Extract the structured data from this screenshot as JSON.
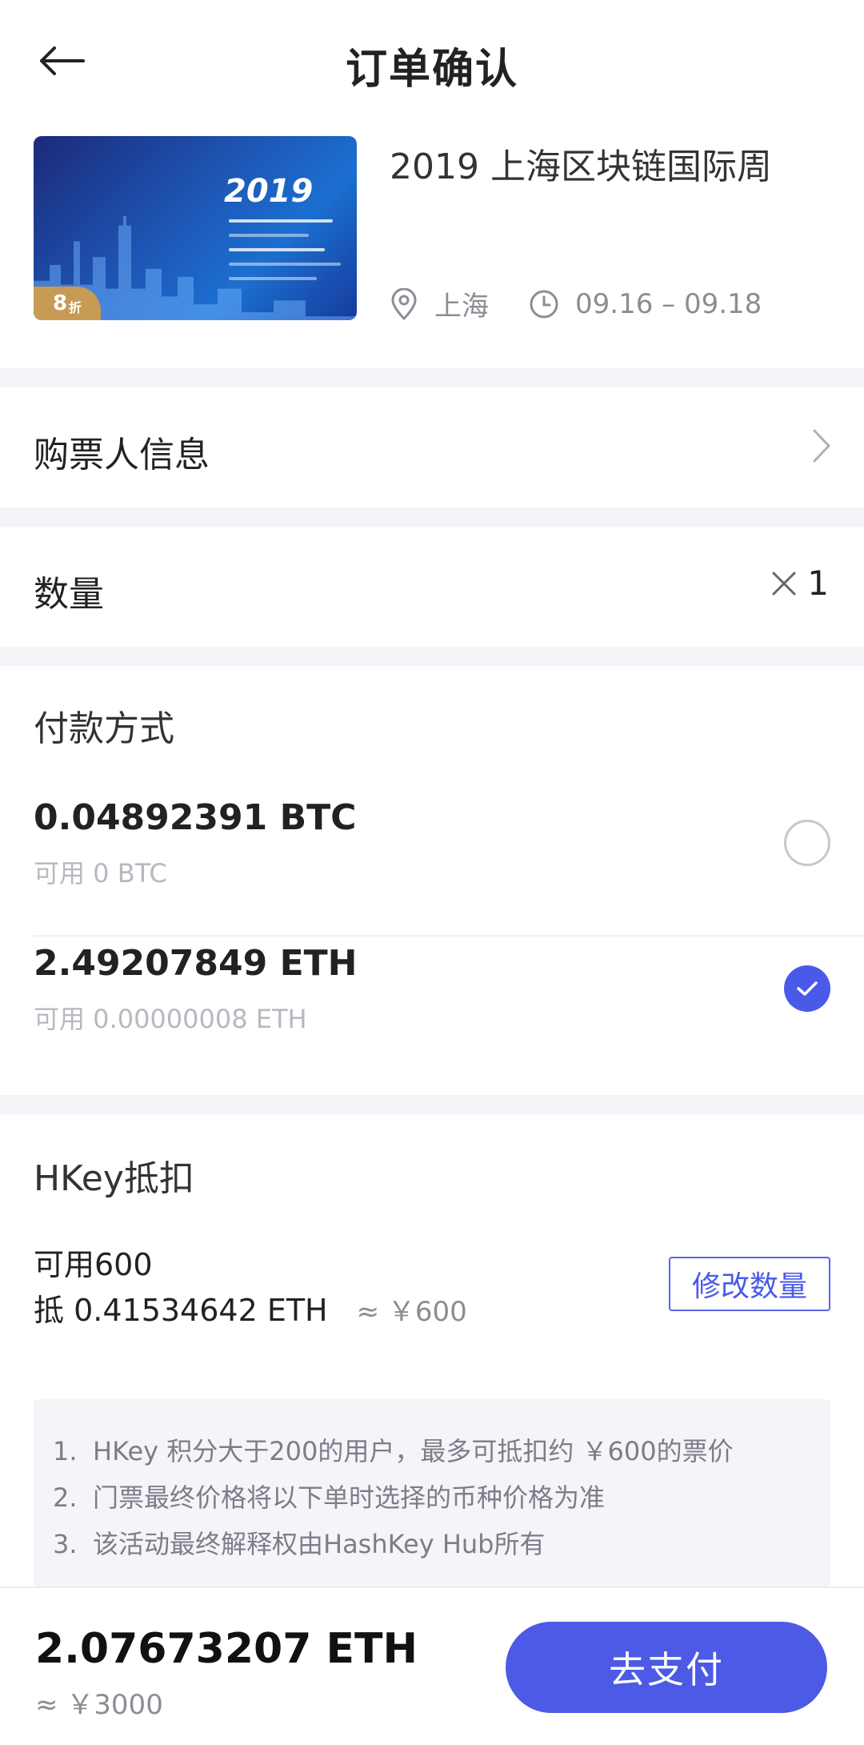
{
  "header": {
    "title": "订单确认"
  },
  "event": {
    "title": "2019 上海区块链国际周",
    "location": "上海",
    "dates": "09.16 – 09.18",
    "discount": "8",
    "discount_unit": "折",
    "poster_year": "2019"
  },
  "buyer": {
    "label": "购票人信息"
  },
  "quantity": {
    "label": "数量",
    "value": "1"
  },
  "payment": {
    "title": "付款方式",
    "options": [
      {
        "amount": "0.04892391 BTC",
        "available": "可用 0 BTC",
        "selected": false
      },
      {
        "amount": "2.49207849 ETH",
        "available": "可用 0.00000008 ETH",
        "selected": true
      }
    ]
  },
  "hkey": {
    "title": "HKey抵扣",
    "available": "可用600",
    "deduct": "抵 0.41534642 ETH",
    "deduct_cny": "≈ ￥600",
    "modify_label": "修改数量",
    "notes": [
      {
        "num": "1.",
        "text": "HKey 积分大于200的用户，最多可抵扣约 ￥600的票价"
      },
      {
        "num": "2.",
        "text": "门票最终价格将以下单时选择的币种价格为准"
      },
      {
        "num": "3.",
        "text": "该活动最终解释权由HashKey Hub所有"
      }
    ]
  },
  "footer": {
    "total": "2.07673207 ETH",
    "total_cny": "≈ ￥3000",
    "pay_label": "去支付"
  },
  "colors": {
    "accent": "#4c5ae6",
    "badge": "#c79a55",
    "divider": "#f4f4f8"
  }
}
